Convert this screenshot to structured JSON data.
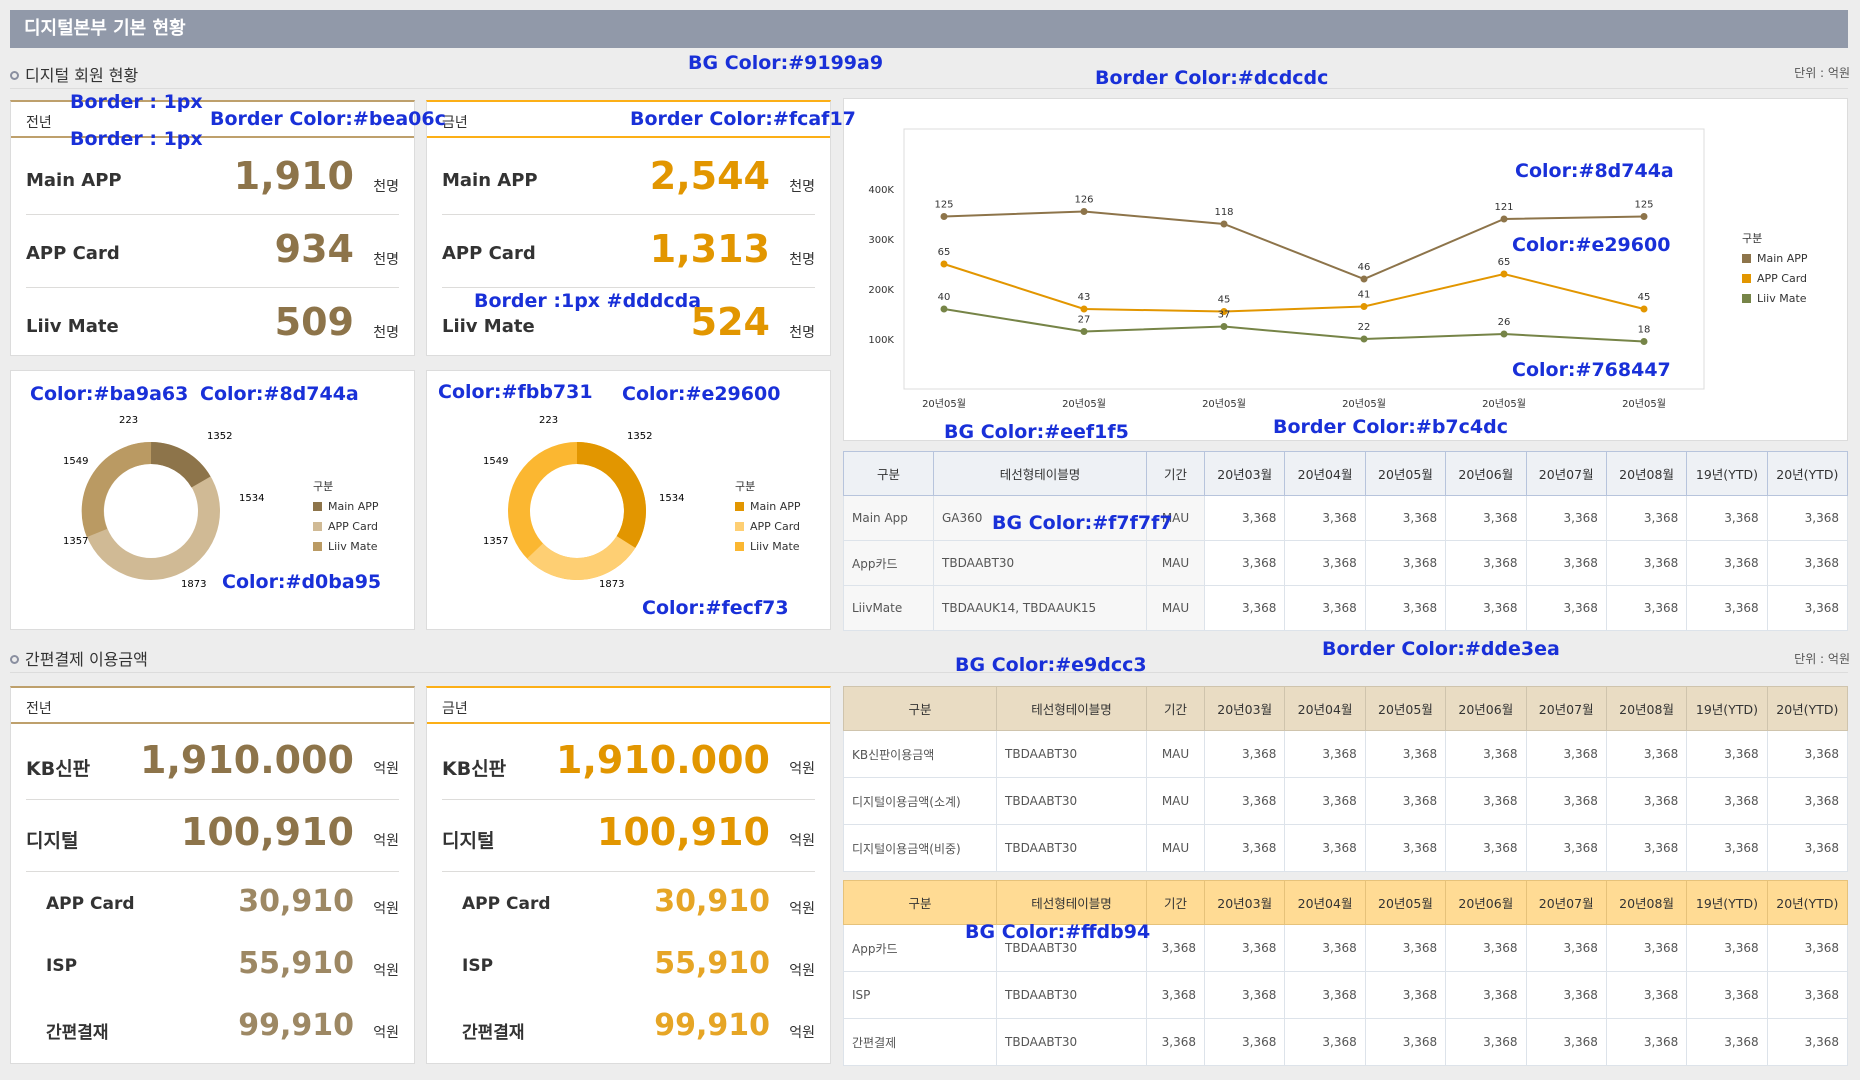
{
  "header": {
    "title": "디지털본부 기본 현황"
  },
  "section1": {
    "title": "디지털 회원 현황",
    "unit": "단위 : 억원"
  },
  "section2": {
    "title": "간편결제 이용금액",
    "unit": "단위 : 억원"
  },
  "members_prev": {
    "title": "전년",
    "rows": [
      {
        "label": "Main APP",
        "value": "1,910",
        "unit": "천명"
      },
      {
        "label": "APP Card",
        "value": "934",
        "unit": "천명"
      },
      {
        "label": "Liiv Mate",
        "value": "509",
        "unit": "천명"
      }
    ]
  },
  "members_cur": {
    "title": "금년",
    "rows": [
      {
        "label": "Main APP",
        "value": "2,544",
        "unit": "천명"
      },
      {
        "label": "APP Card",
        "value": "1,313",
        "unit": "천명"
      },
      {
        "label": "Liiv Mate",
        "value": "524",
        "unit": "천명"
      }
    ]
  },
  "donut_prev": {
    "labels": [
      "1352",
      "1534",
      "1873",
      "1357",
      "1549",
      "223"
    ],
    "legend_title": "구분",
    "legend": [
      "Main APP",
      "APP Card",
      "Liiv Mate"
    ],
    "colors": [
      "#8d744a",
      "#d0ba95",
      "#ba9a63"
    ]
  },
  "donut_cur": {
    "labels": [
      "1352",
      "1534",
      "1873",
      "1357",
      "1549",
      "223"
    ],
    "legend_title": "구분",
    "legend": [
      "Main APP",
      "APP Card",
      "Liiv Mate"
    ],
    "colors": [
      "#e29600",
      "#fecf73",
      "#fbb731"
    ]
  },
  "chart_data": {
    "type": "line",
    "x": [
      "20년05월",
      "20년05월",
      "20년05월",
      "20년05월",
      "20년05월",
      "20년05월"
    ],
    "yticks": [
      "100K",
      "200K",
      "300K",
      "400K"
    ],
    "ylim": [
      0,
      500
    ],
    "legend_title": "구분",
    "series": [
      {
        "name": "Main APP",
        "color": "#8d744a",
        "values": [
          125,
          126,
          118,
          46,
          121,
          125
        ],
        "pos": [
          345,
          355,
          330,
          220,
          340,
          345
        ]
      },
      {
        "name": "APP Card",
        "color": "#e29600",
        "values": [
          65,
          43,
          45,
          41,
          65,
          45
        ],
        "pos": [
          250,
          160,
          155,
          165,
          230,
          160
        ]
      },
      {
        "name": "Liiv Mate",
        "color": "#768447",
        "values": [
          40,
          27,
          37,
          22,
          26,
          18
        ],
        "pos": [
          160,
          115,
          125,
          100,
          110,
          95
        ]
      }
    ]
  },
  "table_members": {
    "headers": [
      "구분",
      "테선형테이블명",
      "기간",
      "20년03월",
      "20년04월",
      "20년05월",
      "20년06월",
      "20년07월",
      "20년08월",
      "19년(YTD)",
      "20년(YTD)"
    ],
    "rows": [
      [
        "Main App",
        "GA360",
        "MAU",
        "3,368",
        "3,368",
        "3,368",
        "3,368",
        "3,368",
        "3,368",
        "3,368",
        "3,368"
      ],
      [
        "App카드",
        "TBDAABT30",
        "MAU",
        "3,368",
        "3,368",
        "3,368",
        "3,368",
        "3,368",
        "3,368",
        "3,368",
        "3,368"
      ],
      [
        "LiivMate",
        "TBDAAUK14, TBDAAUK15",
        "MAU",
        "3,368",
        "3,368",
        "3,368",
        "3,368",
        "3,368",
        "3,368",
        "3,368",
        "3,368"
      ]
    ]
  },
  "pay_prev": {
    "title": "전년",
    "rows": [
      {
        "label": "KB신판",
        "value": "1,910.000",
        "unit": "억원"
      },
      {
        "label": "디지털",
        "value": "100,910",
        "unit": "억원"
      },
      {
        "label": "APP Card",
        "value": "30,910",
        "unit": "억원"
      },
      {
        "label": "ISP",
        "value": "55,910",
        "unit": "억원"
      },
      {
        "label": "간편결재",
        "value": "99,910",
        "unit": "억원"
      }
    ]
  },
  "pay_cur": {
    "title": "금년",
    "rows": [
      {
        "label": "KB신판",
        "value": "1,910.000",
        "unit": "억원"
      },
      {
        "label": "디지털",
        "value": "100,910",
        "unit": "억원"
      },
      {
        "label": "APP Card",
        "value": "30,910",
        "unit": "억원"
      },
      {
        "label": "ISP",
        "value": "55,910",
        "unit": "억원"
      },
      {
        "label": "간편결재",
        "value": "99,910",
        "unit": "억원"
      }
    ]
  },
  "table_pay1": {
    "headers": [
      "구분",
      "테선형테이블명",
      "기간",
      "20년03월",
      "20년04월",
      "20년05월",
      "20년06월",
      "20년07월",
      "20년08월",
      "19년(YTD)",
      "20년(YTD)"
    ],
    "rows": [
      [
        "KB신판이용금액",
        "TBDAABT30",
        "MAU",
        "3,368",
        "3,368",
        "3,368",
        "3,368",
        "3,368",
        "3,368",
        "3,368",
        "3,368"
      ],
      [
        "디지털이용금액(소계)",
        "TBDAABT30",
        "MAU",
        "3,368",
        "3,368",
        "3,368",
        "3,368",
        "3,368",
        "3,368",
        "3,368",
        "3,368"
      ],
      [
        "디지털이용금액(비중)",
        "TBDAABT30",
        "MAU",
        "3,368",
        "3,368",
        "3,368",
        "3,368",
        "3,368",
        "3,368",
        "3,368",
        "3,368"
      ]
    ]
  },
  "table_pay2": {
    "headers": [
      "구분",
      "테선형테이블명",
      "기간",
      "20년03월",
      "20년04월",
      "20년05월",
      "20년06월",
      "20년07월",
      "20년08월",
      "19년(YTD)",
      "20년(YTD)"
    ],
    "rows": [
      [
        "App카드",
        "TBDAABT30",
        "3,368",
        "3,368",
        "3,368",
        "3,368",
        "3,368",
        "3,368",
        "3,368",
        "3,368",
        "3,368"
      ],
      [
        "ISP",
        "TBDAABT30",
        "3,368",
        "3,368",
        "3,368",
        "3,368",
        "3,368",
        "3,368",
        "3,368",
        "3,368",
        "3,368"
      ],
      [
        "간편결제",
        "TBDAABT30",
        "3,368",
        "3,368",
        "3,368",
        "3,368",
        "3,368",
        "3,368",
        "3,368",
        "3,368",
        "3,368"
      ]
    ]
  },
  "annotations": {
    "a1": "BG Color:#9199a9",
    "a2": "Border Color:#dcdcdc",
    "a3": "Border : 1px",
    "a4": "Border : 1px",
    "a5": "Border Color:#bea06c",
    "a6": "Border Color:#fcaf17",
    "a7": "Border :1px #dddcda",
    "a8": "Color:#8d744a",
    "a9": "Color:#e29600",
    "a10": "Color:#768447",
    "a11": "Color:#ba9a63",
    "a12": "Color:#8d744a",
    "a13": "Color:#d0ba95",
    "a14": "Color:#fbb731",
    "a15": "Color:#e29600",
    "a16": "Color:#fecf73",
    "a17": "BG Color:#eef1f5",
    "a18": "Border Color:#b7c4dc",
    "a19": "BG Color:#f7f7f7",
    "a20": "Border Color:#dde3ea",
    "a21": "BG Color:#e9dcc3",
    "a22": "BG Color:#ffdb94"
  }
}
